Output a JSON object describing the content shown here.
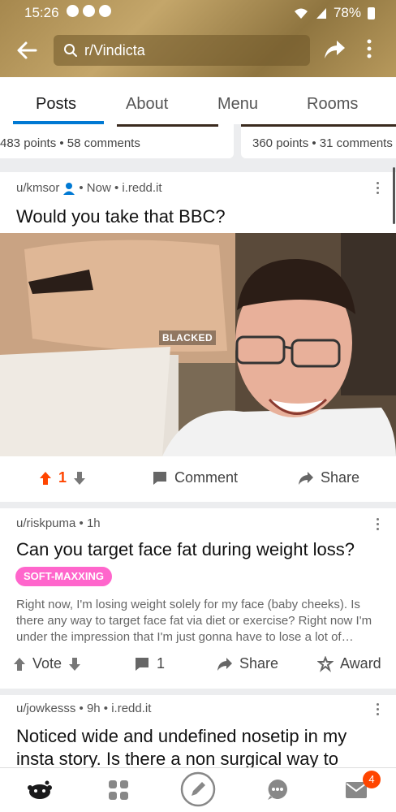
{
  "status_bar": {
    "time": "15:26",
    "battery": "78%"
  },
  "header": {
    "search_query": "r/Vindicta"
  },
  "tabs": [
    {
      "label": "Posts"
    },
    {
      "label": "About"
    },
    {
      "label": "Menu"
    },
    {
      "label": "Rooms"
    }
  ],
  "prev_cards": [
    {
      "stats": "483 points • 58 comments"
    },
    {
      "stats": "360 points • 31 comments"
    }
  ],
  "posts": [
    {
      "user": "u/kmsor",
      "meta": "• Now • i.redd.it",
      "title": "Would you take that BBC?",
      "watermark": "BLACKED",
      "votes": "1",
      "comment_label": "Comment",
      "share_label": "Share"
    },
    {
      "meta": "u/riskpuma • 1h",
      "title": "Can you target face fat during weight loss?",
      "flair": "SOFT-MAXXING",
      "body": "Right now, I'm losing weight solely for my face (baby cheeks). Is there any way to target face fat via diet or exercise? Right now I'm under the impression that I'm just gonna have to lose a lot of…",
      "vote_label": "Vote",
      "comments": "1",
      "share_label": "Share",
      "award_label": "Award"
    },
    {
      "meta": "u/jowkesss • 9h • i.redd.it",
      "title": "Noticed wide and undefined nosetip in my insta story. Is there a non surgical way to"
    }
  ],
  "bottom_nav": {
    "inbox_badge": "4"
  },
  "colors": {
    "accent": "#0079d3",
    "upvote": "#ff4500",
    "flair": "#ff66cc"
  }
}
